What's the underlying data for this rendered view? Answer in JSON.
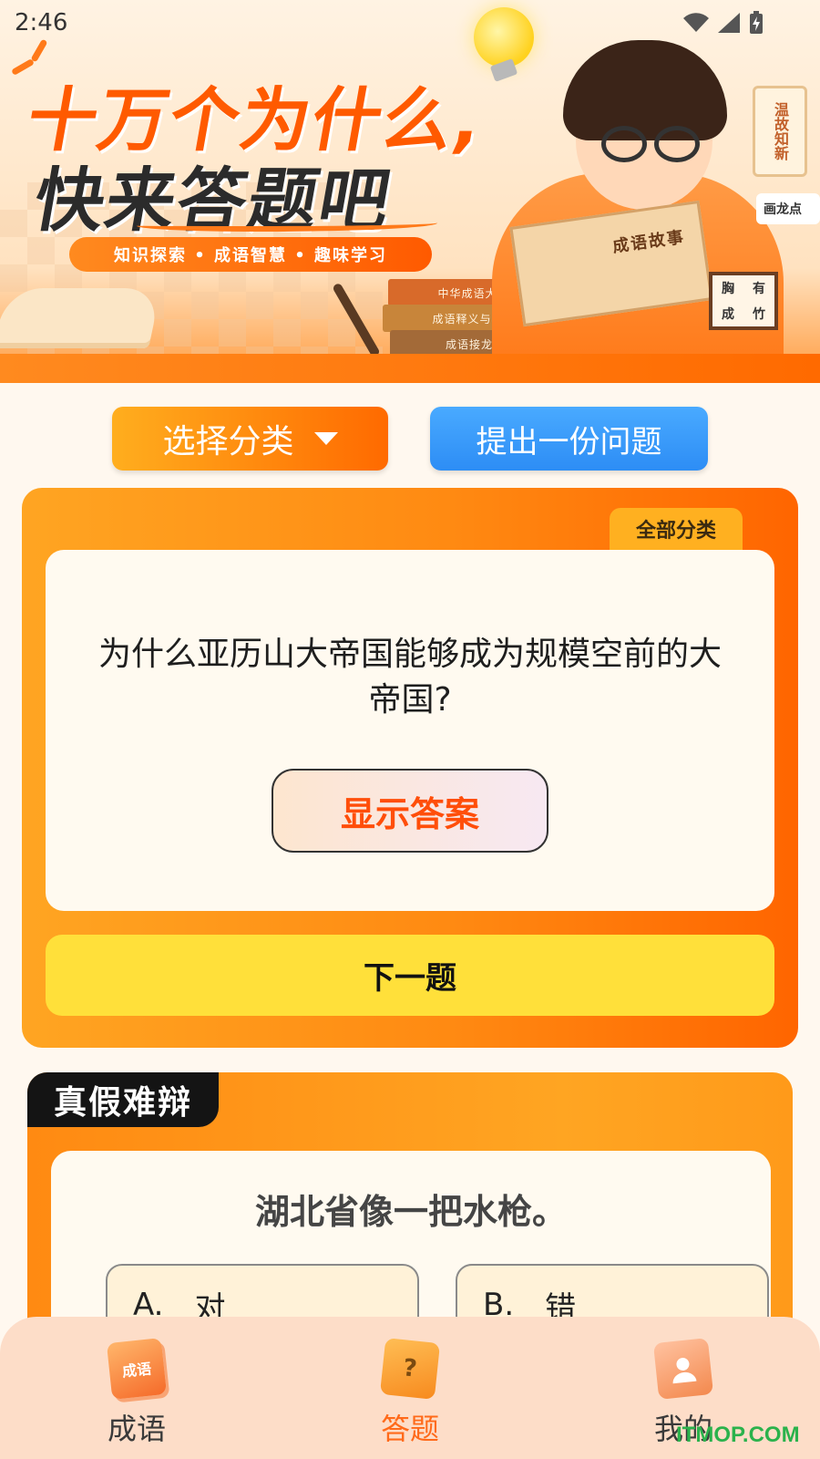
{
  "status_bar": {
    "time": "2:46"
  },
  "banner": {
    "title_line1": "十万个为什么,",
    "title_line2": "快来答题吧",
    "tagline": "知识探索 • 成语智慧 • 趣味学习",
    "books": [
      "中华成语大词典",
      "成语释义与典故",
      "成语接龙大全"
    ],
    "held_book": "成语故事",
    "scroll_text": "温故知新",
    "tag_text": "画龙点",
    "board_chars": [
      "胸",
      "有",
      "成",
      "竹"
    ]
  },
  "actions": {
    "category_label": "选择分类",
    "ask_label": "提出一份问题"
  },
  "question": {
    "category_tab": "全部分类",
    "text": "为什么亚历山大帝国能够成为规模空前的大帝国?",
    "show_answer_label": "显示答案",
    "next_label": "下一题"
  },
  "true_false": {
    "title": "真假难辩",
    "statement": "湖北省像一把水枪。",
    "options": [
      {
        "letter": "A.",
        "text": "对"
      },
      {
        "letter": "B.",
        "text": "错"
      }
    ]
  },
  "bottom_nav": {
    "items": [
      {
        "label": "成语",
        "icon": "idiom-book-icon",
        "icon_text": "成语",
        "active": false
      },
      {
        "label": "答题",
        "icon": "quiz-clipboard-icon",
        "icon_text": "?",
        "active": true
      },
      {
        "label": "我的",
        "icon": "profile-card-icon",
        "icon_text": "",
        "active": false
      }
    ]
  },
  "watermark": "ITMOP.COM",
  "colors": {
    "accent_orange": "#ff6a00",
    "ask_blue": "#2d8df5",
    "next_yellow": "#ffe03a",
    "active_nav": "#ff6a1a"
  }
}
